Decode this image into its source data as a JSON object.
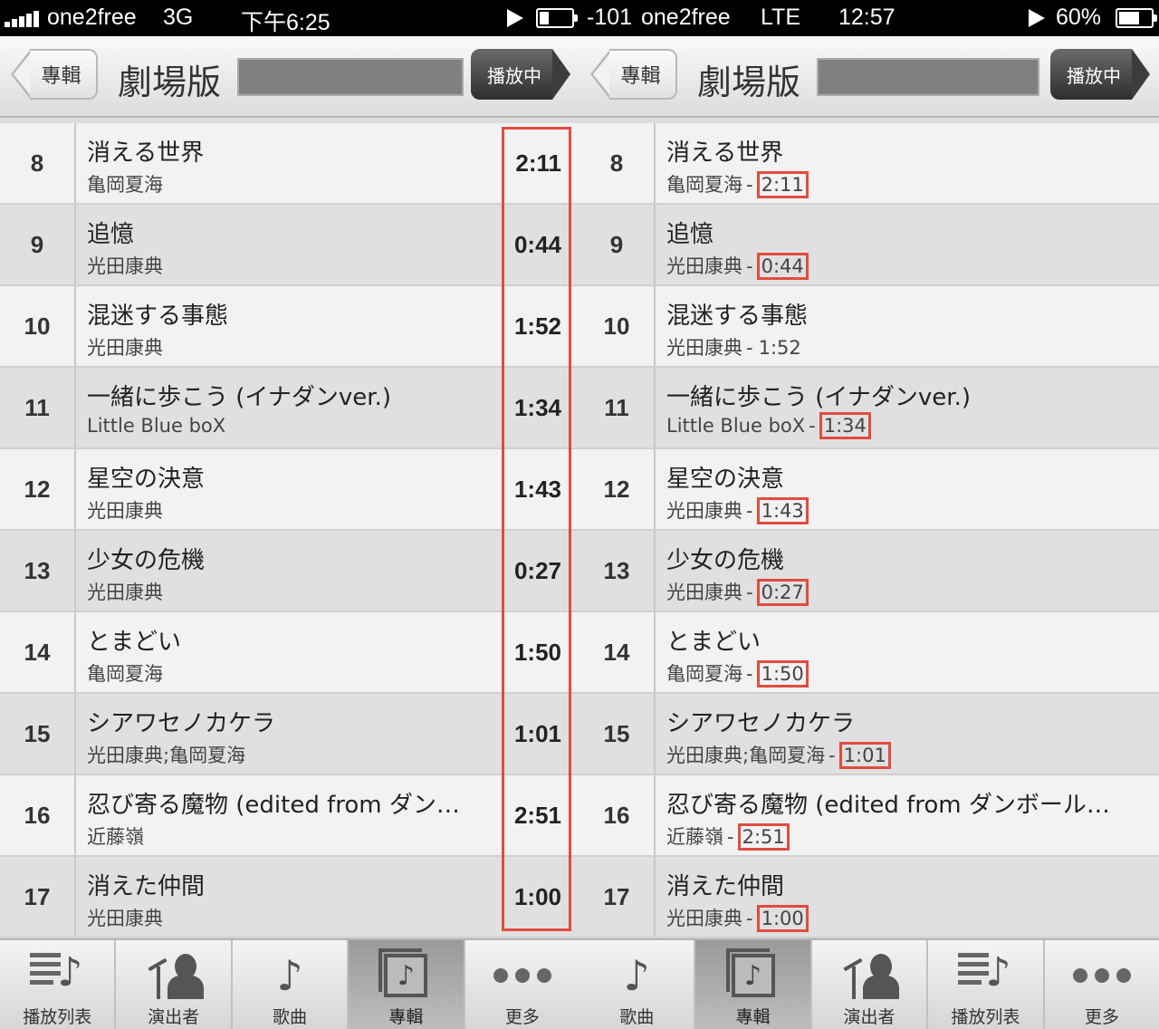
{
  "left": {
    "status": {
      "carrier": "one2free",
      "network": "3G",
      "time": "下午6:25"
    },
    "nav": {
      "back_label": "專輯",
      "title": "劇場版",
      "now_playing_label": "播放中"
    },
    "tracks": [
      {
        "num": "8",
        "title": "消える世界",
        "artist": "亀岡夏海",
        "duration": "2:11"
      },
      {
        "num": "9",
        "title": "追憶",
        "artist": "光田康典",
        "duration": "0:44"
      },
      {
        "num": "10",
        "title": "混迷する事態",
        "artist": "光田康典",
        "duration": "1:52"
      },
      {
        "num": "11",
        "title": "一緒に歩こう (イナダンver.)",
        "artist": "Little Blue boX",
        "duration": "1:34"
      },
      {
        "num": "12",
        "title": "星空の決意",
        "artist": "光田康典",
        "duration": "1:43"
      },
      {
        "num": "13",
        "title": "少女の危機",
        "artist": "光田康典",
        "duration": "0:27"
      },
      {
        "num": "14",
        "title": "とまどい",
        "artist": "亀岡夏海",
        "duration": "1:50"
      },
      {
        "num": "15",
        "title": "シアワセノカケラ",
        "artist": "光田康典;亀岡夏海",
        "duration": "1:01"
      },
      {
        "num": "16",
        "title": "忍び寄る魔物 (edited from ダン…",
        "artist": "近藤嶺",
        "duration": "2:51"
      },
      {
        "num": "17",
        "title": "消えた仲間",
        "artist": "光田康典",
        "duration": "1:00"
      }
    ],
    "tabs": [
      {
        "label": "播放列表",
        "icon": "playlist-icon",
        "active": false
      },
      {
        "label": "演出者",
        "icon": "artist-icon",
        "active": false
      },
      {
        "label": "歌曲",
        "icon": "music-note-icon",
        "active": false
      },
      {
        "label": "專輯",
        "icon": "album-icon",
        "active": true
      },
      {
        "label": "更多",
        "icon": "more-icon",
        "active": false
      }
    ]
  },
  "right": {
    "status": {
      "signal": "-101",
      "carrier": "one2free",
      "network": "LTE",
      "time": "12:57",
      "battery": "60%"
    },
    "nav": {
      "back_label": "專輯",
      "title": "劇場版",
      "now_playing_label": "播放中"
    },
    "separator": "-",
    "tracks": [
      {
        "num": "8",
        "title": "消える世界",
        "artist": "亀岡夏海",
        "duration": "2:11",
        "highlight": true
      },
      {
        "num": "9",
        "title": "追憶",
        "artist": "光田康典",
        "duration": "0:44",
        "highlight": true
      },
      {
        "num": "10",
        "title": "混迷する事態",
        "artist": "光田康典",
        "duration": "1:52",
        "highlight": false
      },
      {
        "num": "11",
        "title": "一緒に歩こう (イナダンver.)",
        "artist": "Little Blue boX",
        "duration": "1:34",
        "highlight": true
      },
      {
        "num": "12",
        "title": "星空の決意",
        "artist": "光田康典",
        "duration": "1:43",
        "highlight": true
      },
      {
        "num": "13",
        "title": "少女の危機",
        "artist": "光田康典",
        "duration": "0:27",
        "highlight": true
      },
      {
        "num": "14",
        "title": "とまどい",
        "artist": "亀岡夏海",
        "duration": "1:50",
        "highlight": true
      },
      {
        "num": "15",
        "title": "シアワセノカケラ",
        "artist": "光田康典;亀岡夏海",
        "duration": "1:01",
        "highlight": true
      },
      {
        "num": "16",
        "title": "忍び寄る魔物 (edited from ダンボール…",
        "artist": "近藤嶺",
        "duration": "2:51",
        "highlight": true
      },
      {
        "num": "17",
        "title": "消えた仲間",
        "artist": "光田康典",
        "duration": "1:00",
        "highlight": true
      }
    ],
    "tabs": [
      {
        "label": "歌曲",
        "icon": "music-note-icon",
        "active": false
      },
      {
        "label": "專輯",
        "icon": "album-icon",
        "active": true
      },
      {
        "label": "演出者",
        "icon": "artist-icon",
        "active": false
      },
      {
        "label": "播放列表",
        "icon": "playlist-icon",
        "active": false
      },
      {
        "label": "更多",
        "icon": "more-icon",
        "active": false
      }
    ]
  },
  "colors": {
    "highlight_box": "#e24c3f",
    "row_alt": "#e0e0e0",
    "row": "#f2f2f2"
  }
}
